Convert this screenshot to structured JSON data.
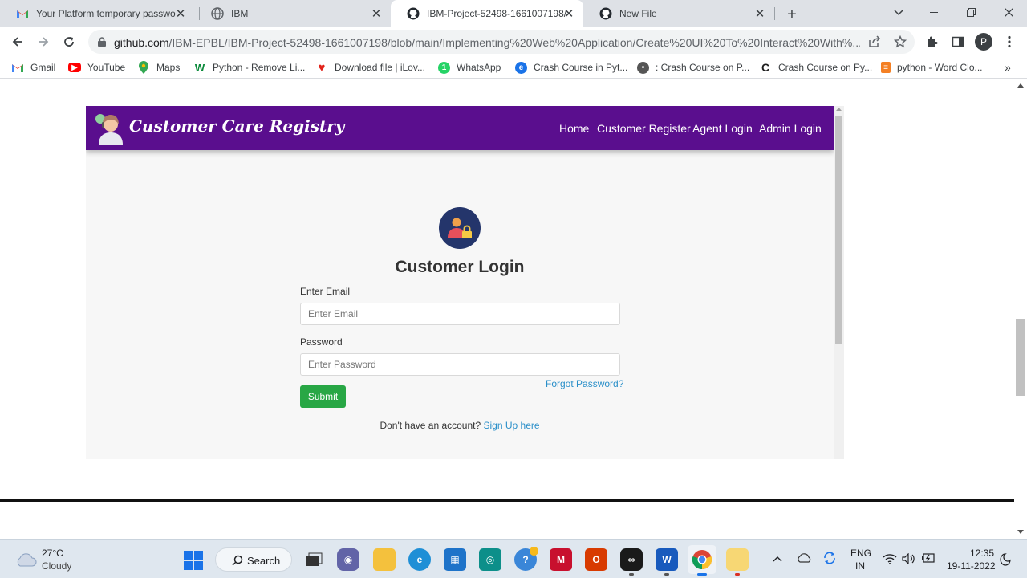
{
  "browser": {
    "tabs": [
      {
        "title": "Your Platform temporary passwo",
        "icon": "gmail-icon"
      },
      {
        "title": "IBM",
        "icon": "globe-icon"
      },
      {
        "title": "IBM-Project-52498-1661007198/",
        "icon": "github-icon"
      },
      {
        "title": "New File",
        "icon": "github-icon"
      }
    ],
    "url_host": "github.com",
    "url_path": "/IBM-EPBL/IBM-Project-52498-1661007198/blob/main/Implementing%20Web%20Application/Create%20UI%20To%20Interact%20With%...",
    "profile_initial": "P",
    "bookmarks": [
      {
        "label": "Gmail"
      },
      {
        "label": "YouTube"
      },
      {
        "label": "Maps"
      },
      {
        "label": "Python - Remove Li..."
      },
      {
        "label": "Download file | iLov..."
      },
      {
        "label": "WhatsApp"
      },
      {
        "label": "Crash Course in Pyt..."
      },
      {
        "label": ": Crash Course on P..."
      },
      {
        "label": "Crash Course on Py..."
      },
      {
        "label": "python - Word Clo..."
      }
    ],
    "bookmarks_overflow": "»"
  },
  "app": {
    "brand": "Customer Care Registry",
    "nav": [
      "Home",
      "Customer Register",
      "Agent Login",
      "Admin Login"
    ],
    "login": {
      "title": "Customer Login",
      "email_label": "Enter Email",
      "email_placeholder": "Enter Email",
      "password_label": "Password",
      "password_placeholder": "Enter Password",
      "forgot": "Forgot Password?",
      "submit": "Submit",
      "signup_prompt": "Don't have an account?",
      "signup_link": "Sign Up here"
    }
  },
  "taskbar": {
    "weather_temp": "27°C",
    "weather_desc": "Cloudy",
    "search_label": "Search",
    "lang_top": "ENG",
    "lang_bottom": "IN",
    "time": "12:35",
    "date": "19-11-2022"
  },
  "colors": {
    "navbar": "#5a0e8e",
    "submit": "#28a745",
    "link": "#2a8fc9"
  }
}
